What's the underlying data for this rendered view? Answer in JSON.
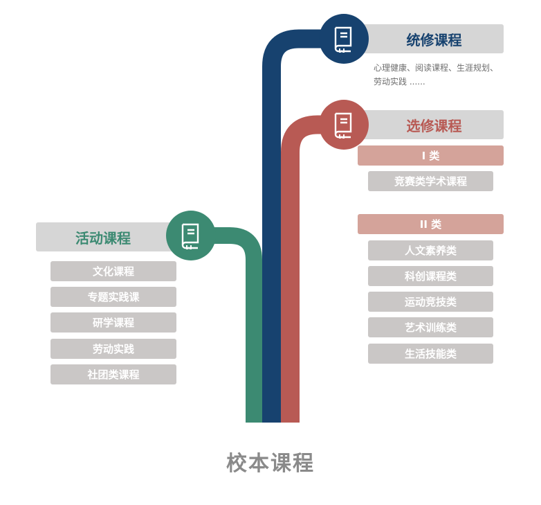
{
  "colors": {
    "required": "#17426f",
    "elective": "#b85a54",
    "activity": "#3c8a72",
    "header_bg": "#d6d6d6",
    "category_bg": "#d4a39a",
    "item_bg": "#cac7c6",
    "title": "#8a8a8a"
  },
  "title": "校本课程",
  "branches": {
    "required": {
      "icon": "book-icon",
      "label": "统修课程",
      "description_line1": "心理健康、阅读课程、生涯规划、",
      "description_line2": "劳动实践 ......"
    },
    "elective": {
      "icon": "book-icon",
      "label": "选修课程",
      "categories": [
        {
          "label": "I 类",
          "items": [
            "竞赛类学术课程"
          ]
        },
        {
          "label": "II 类",
          "items": [
            "人文素养类",
            "科创课程类",
            "运动竞技类",
            "艺术训练类",
            "生活技能类"
          ]
        }
      ]
    },
    "activity": {
      "icon": "book-icon",
      "label": "活动课程",
      "items": [
        "文化课程",
        "专题实践课",
        "研学课程",
        "劳动实践",
        "社团类课程"
      ]
    }
  }
}
